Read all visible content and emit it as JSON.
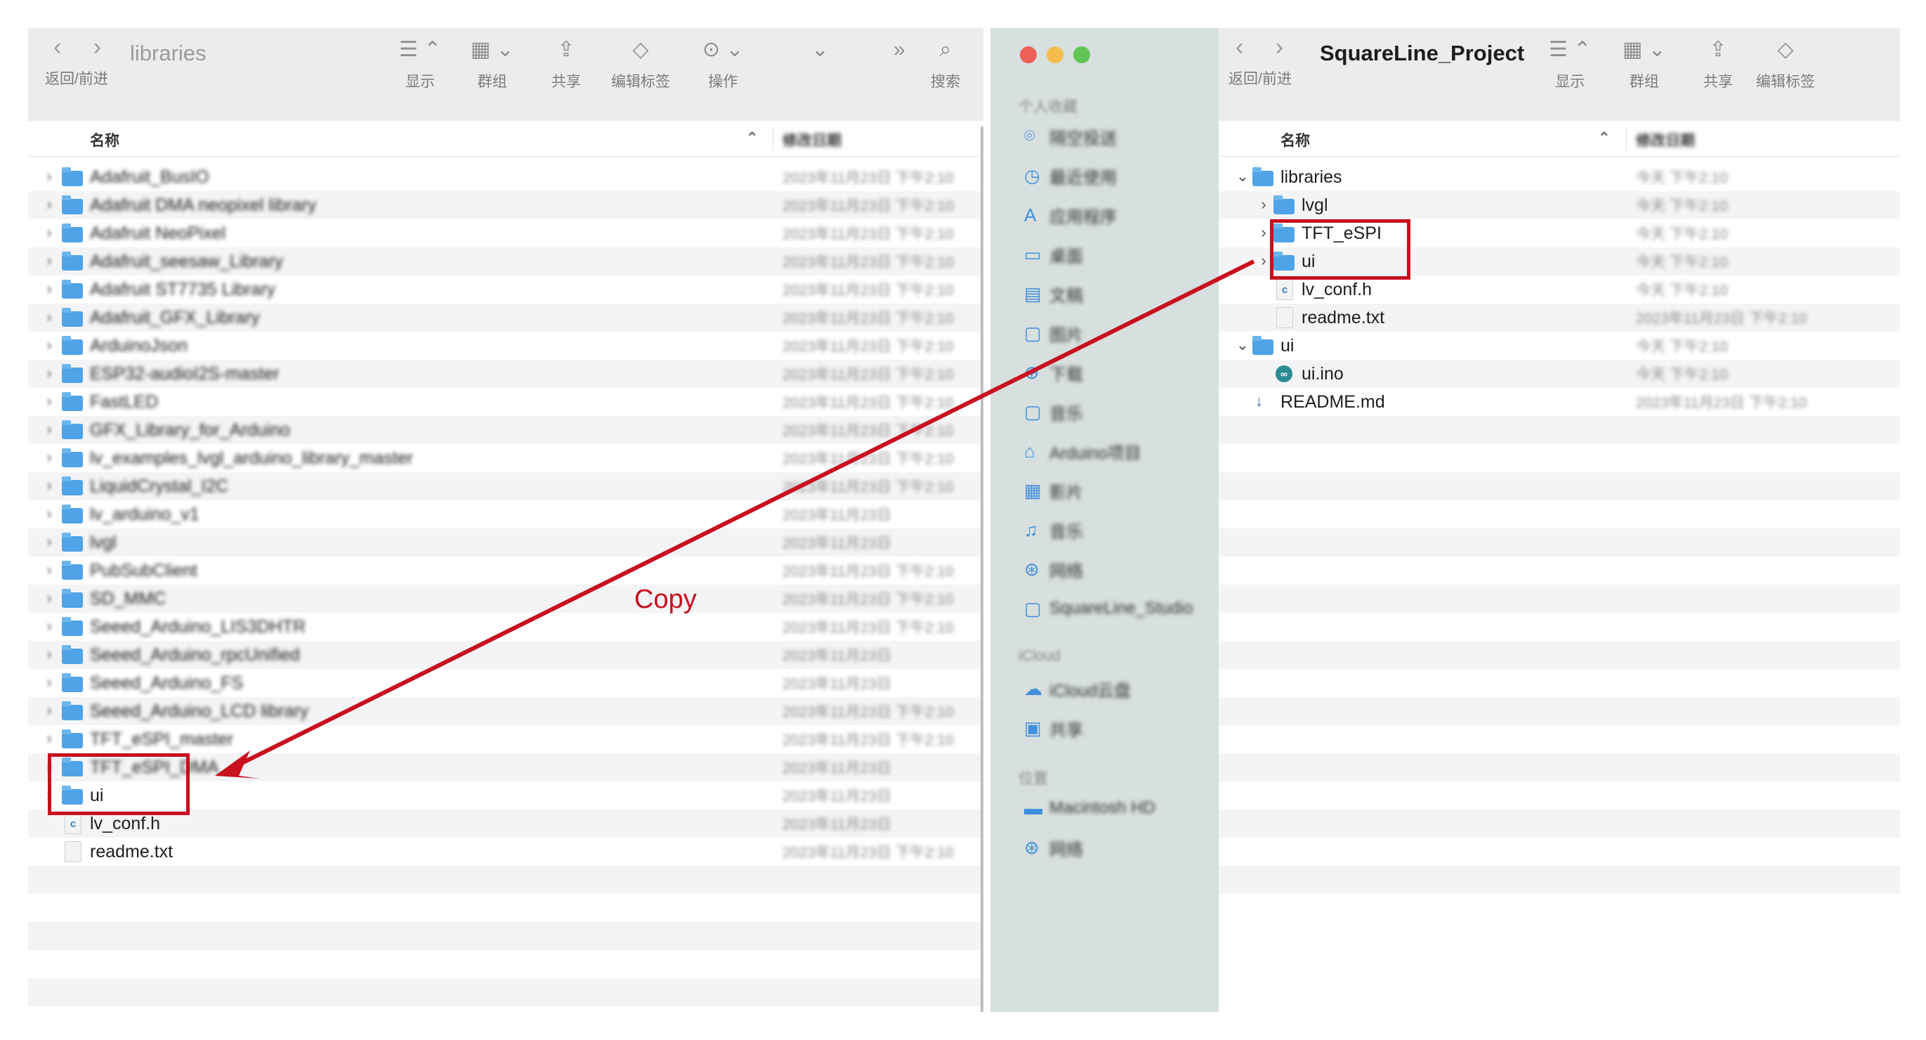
{
  "left_window": {
    "title": "libraries",
    "nav_label": "返回/前进",
    "toolbar": [
      {
        "icon": "list-view-icon",
        "glyph": "☰ ⌃",
        "label": "显示"
      },
      {
        "icon": "group-icon",
        "glyph": "▦ ⌄",
        "label": "群组"
      },
      {
        "icon": "share-icon",
        "glyph": "⇪",
        "label": "共享"
      },
      {
        "icon": "tag-icon",
        "glyph": "◇",
        "label": "编辑标签"
      },
      {
        "icon": "action-icon",
        "glyph": "⊙ ⌄",
        "label": "操作"
      },
      {
        "icon": "chevron-down-icon",
        "glyph": "⌄",
        "label": ""
      },
      {
        "icon": "more-icon",
        "glyph": "»",
        "label": ""
      },
      {
        "icon": "search-icon",
        "glyph": "⌕",
        "label": "搜索"
      }
    ],
    "columns": {
      "name": "名称",
      "date": "修改日期"
    },
    "rows": [
      {
        "name": "Adafruit_BusIO",
        "date": "2023年11月23日 下午2:10",
        "type": "folder"
      },
      {
        "name": "Adafruit DMA neopixel library",
        "date": "2023年11月23日 下午2:10",
        "type": "folder"
      },
      {
        "name": "Adafruit NeoPixel",
        "date": "2023年11月23日 下午2:10",
        "type": "folder"
      },
      {
        "name": "Adafruit_seesaw_Library",
        "date": "2023年11月23日 下午2:10",
        "type": "folder"
      },
      {
        "name": "Adafruit ST7735 Library",
        "date": "2023年11月23日 下午2:10",
        "type": "folder"
      },
      {
        "name": "Adafruit_GFX_Library",
        "date": "2023年11月23日 下午2:10",
        "type": "folder"
      },
      {
        "name": "ArduinoJson",
        "date": "2023年11月23日 下午2:10",
        "type": "folder"
      },
      {
        "name": "ESP32-audioI2S-master",
        "date": "2023年11月23日 下午2:10",
        "type": "folder"
      },
      {
        "name": "FastLED",
        "date": "2023年11月23日 下午2:10",
        "type": "folder"
      },
      {
        "name": "GFX_Library_for_Arduino",
        "date": "2023年11月23日 下午2:10",
        "type": "folder"
      },
      {
        "name": "lv_examples_lvgl_arduino_library_master",
        "date": "2023年11月23日 下午2:10",
        "type": "folder"
      },
      {
        "name": "LiquidCrystal_I2C",
        "date": "2023年11月23日 下午2:10",
        "type": "folder"
      },
      {
        "name": "lv_arduino_v1",
        "date": "2023年11月23日",
        "type": "folder"
      },
      {
        "name": "lvgl",
        "date": "2023年11月23日",
        "type": "folder"
      },
      {
        "name": "PubSubClient",
        "date": "2023年11月23日 下午2:10",
        "type": "folder"
      },
      {
        "name": "SD_MMC",
        "date": "2023年11月23日 下午2:10",
        "type": "folder"
      },
      {
        "name": "Seeed_Arduino_LIS3DHTR",
        "date": "2023年11月23日 下午2:10",
        "type": "folder"
      },
      {
        "name": "Seeed_Arduino_rpcUnified",
        "date": "2023年11月23日",
        "type": "folder"
      },
      {
        "name": "Seeed_Arduino_FS",
        "date": "2023年11月23日",
        "type": "folder"
      },
      {
        "name": "Seeed_Arduino_LCD library",
        "date": "2023年11月23日 下午2:10",
        "type": "folder"
      },
      {
        "name": "TFT_eSPI_master",
        "date": "2023年11月23日 下午2:10",
        "type": "folder"
      },
      {
        "name": "TFT_eSPI_DMA",
        "date": "2023年11月23日",
        "type": "folder"
      },
      {
        "name": "ui",
        "date": "2023年11月23日",
        "type": "folder",
        "clear": true
      },
      {
        "name": "lv_conf.h",
        "date": "2023年11月23日",
        "type": "c",
        "clear": true
      },
      {
        "name": "readme.txt",
        "date": "2023年11月23日 下午2:10",
        "type": "txt",
        "clear": true
      }
    ]
  },
  "sidebar": {
    "sections": [
      {
        "head": "个人收藏",
        "items": [
          {
            "icon": "airdrop-icon",
            "glyph": "⌾",
            "label": "隔空投送"
          },
          {
            "icon": "recents-icon",
            "glyph": "◷",
            "label": "最近使用"
          },
          {
            "icon": "applications-icon",
            "glyph": "A",
            "label": "应用程序"
          },
          {
            "icon": "desktop-icon",
            "glyph": "▭",
            "label": "桌面"
          },
          {
            "icon": "documents-icon",
            "glyph": "▤",
            "label": "文稿"
          },
          {
            "icon": "folder-icon",
            "glyph": "▢",
            "label": "图片"
          },
          {
            "icon": "downloads-icon",
            "glyph": "⊕",
            "label": "下载"
          },
          {
            "icon": "folder-icon",
            "glyph": "▢",
            "label": "音乐"
          },
          {
            "icon": "home-icon",
            "glyph": "⌂",
            "label": "Arduino项目"
          },
          {
            "icon": "movies-icon",
            "glyph": "▦",
            "label": "影片"
          },
          {
            "icon": "music-icon",
            "glyph": "♫",
            "label": "音乐"
          },
          {
            "icon": "network-icon",
            "glyph": "⊛",
            "label": "网络"
          },
          {
            "icon": "folder-icon",
            "glyph": "▢",
            "label": "SquareLine_Studio"
          }
        ]
      },
      {
        "head": "iCloud",
        "items": [
          {
            "icon": "icloud-icon",
            "glyph": "☁",
            "label": "iCloud云盘"
          },
          {
            "icon": "shared-icon",
            "glyph": "▣",
            "label": "共享"
          }
        ]
      },
      {
        "head": "位置",
        "items": [
          {
            "icon": "disk-icon",
            "glyph": "▬",
            "label": "Macintosh HD"
          },
          {
            "icon": "network-icon",
            "glyph": "⊛",
            "label": "网络"
          }
        ]
      }
    ]
  },
  "right_window": {
    "title": "SquareLine_Project",
    "nav_label": "返回/前进",
    "toolbar": [
      {
        "icon": "list-view-icon",
        "glyph": "☰ ⌃",
        "label": "显示"
      },
      {
        "icon": "group-icon",
        "glyph": "▦ ⌄",
        "label": "群组"
      },
      {
        "icon": "share-icon",
        "glyph": "⇪",
        "label": "共享"
      },
      {
        "icon": "tag-icon",
        "glyph": "◇",
        "label": "编辑标签"
      }
    ],
    "columns": {
      "name": "名称",
      "date": "修改日期"
    },
    "rows": [
      {
        "name": "libraries",
        "date": "今天 下午2:10",
        "type": "folder",
        "indent": 0,
        "disc": "⌄"
      },
      {
        "name": "lvgl",
        "date": "今天 下午2:10",
        "type": "folder",
        "indent": 1,
        "disc": "›"
      },
      {
        "name": "TFT_eSPI",
        "date": "今天 下午2:10",
        "type": "folder",
        "indent": 1,
        "disc": "›"
      },
      {
        "name": "ui",
        "date": "今天 下午2:10",
        "type": "folder",
        "indent": 1,
        "disc": "›"
      },
      {
        "name": "lv_conf.h",
        "date": "今天 下午2:10",
        "type": "c",
        "indent": 1,
        "disc": ""
      },
      {
        "name": "readme.txt",
        "date": "2023年11月23日 下午2:10",
        "type": "txt",
        "indent": 1,
        "disc": ""
      },
      {
        "name": "ui",
        "date": "今天 下午2:10",
        "type": "folder",
        "indent": 0,
        "disc": "⌄"
      },
      {
        "name": "ui.ino",
        "date": "今天 下午2:10",
        "type": "ino",
        "indent": 1,
        "disc": ""
      },
      {
        "name": "README.md",
        "date": "2023年11月23日 下午2:10",
        "type": "md",
        "indent": 0,
        "disc": ""
      }
    ]
  },
  "annotation": {
    "copy_label": "Copy",
    "color": "#c8101f"
  }
}
